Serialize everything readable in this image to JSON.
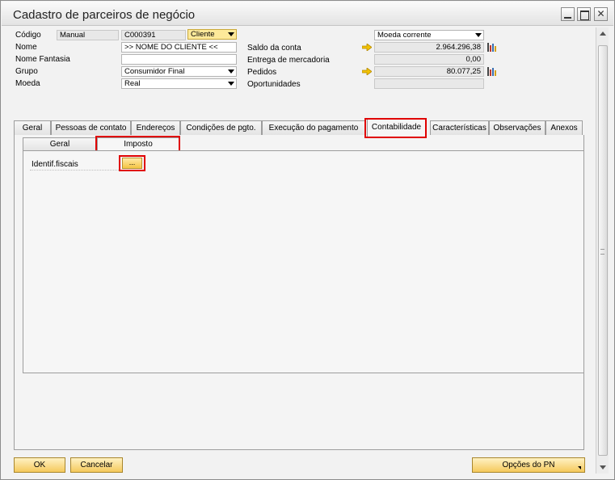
{
  "window": {
    "title": "Cadastro de parceiros de negócio"
  },
  "header": {
    "codigo_label": "Código",
    "codigo_series": "Manual",
    "codigo_value": "C000391",
    "tipo_value": "Cliente",
    "nome_label": "Nome",
    "nome_value": ">> NOME DO CLIENTE <<",
    "nome_fantasia_label": "Nome Fantasia",
    "nome_fantasia_value": "",
    "grupo_label": "Grupo",
    "grupo_value": "Consumidor Final",
    "moeda_label": "Moeda",
    "moeda_value": "Real"
  },
  "summary": {
    "moeda_corrente": "Moeda corrente",
    "saldo_label": "Saldo da conta",
    "saldo_value": "2.964.296,38",
    "entrega_label": "Entrega de mercadoria",
    "entrega_value": "0,00",
    "pedidos_label": "Pedidos",
    "pedidos_value": "80.077,25",
    "oportunidades_label": "Oportunidades",
    "oportunidades_value": ""
  },
  "tabs": [
    {
      "label": "Geral"
    },
    {
      "label": "Pessoas de contato"
    },
    {
      "label": "Endereços"
    },
    {
      "label": "Condições de pgto."
    },
    {
      "label": "Execução do pagamento"
    },
    {
      "label": "Contabilidade"
    },
    {
      "label": "Características"
    },
    {
      "label": "Observações"
    },
    {
      "label": "Anexos"
    }
  ],
  "subtabs": [
    {
      "label": "Geral"
    },
    {
      "label": "Imposto"
    }
  ],
  "imposto": {
    "identif_label": "Identif.fiscais",
    "dots_label": "..."
  },
  "footer": {
    "ok_label": "OK",
    "cancel_label": "Cancelar",
    "options_label": "Opções do PN"
  },
  "colors": {
    "highlight_red": "#e00000",
    "button_yellow": "#f5c95c"
  }
}
